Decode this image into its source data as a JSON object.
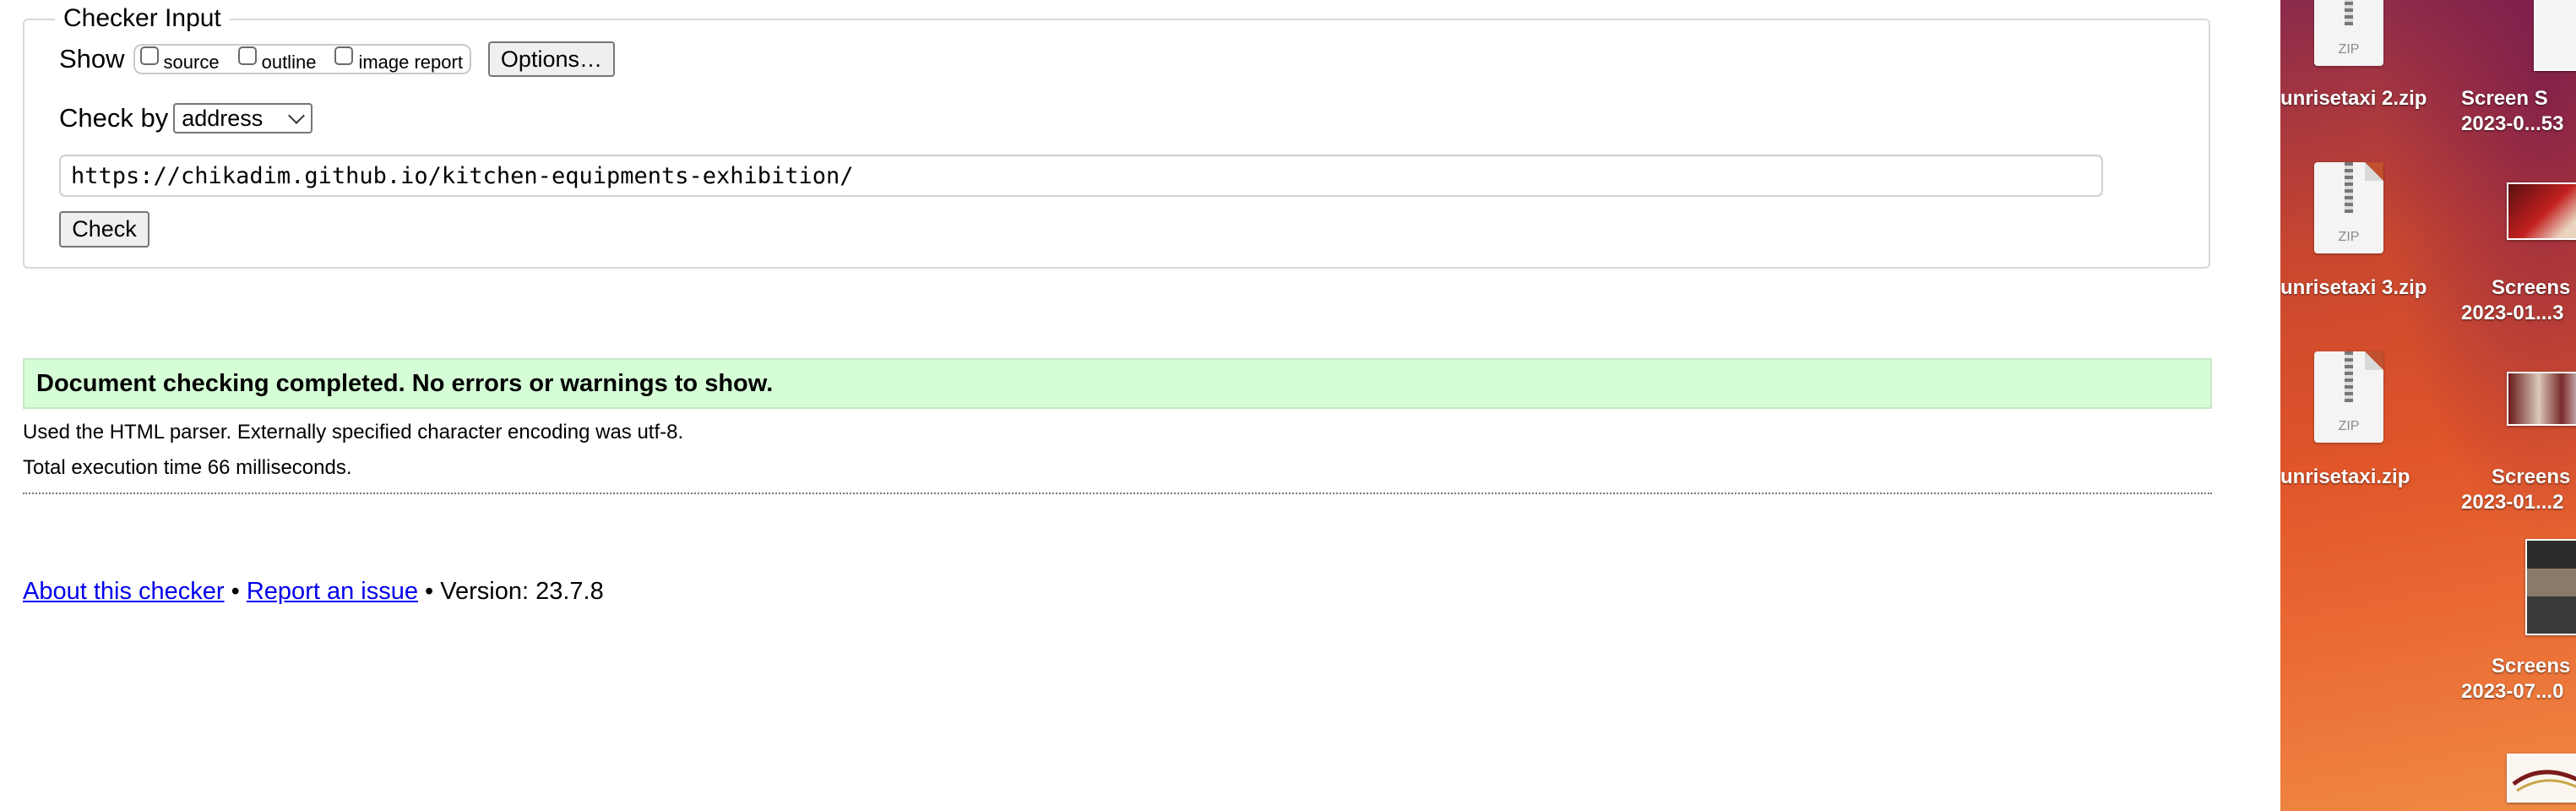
{
  "checker": {
    "legend": "Checker Input",
    "show_label": "Show",
    "show_options": [
      {
        "label": "source",
        "checked": false
      },
      {
        "label": "outline",
        "checked": false
      },
      {
        "label": "image report",
        "checked": false
      }
    ],
    "options_button": "Options…",
    "check_by_label": "Check by",
    "check_by_value": "address",
    "url": "https://chikadim.github.io/kitchen-equipments-exhibition/",
    "check_button": "Check"
  },
  "result": {
    "success_message": "Document checking completed. No errors or warnings to show.",
    "success_color": "#d5fdd6",
    "parser_info": "Used the HTML parser. Externally specified character encoding was utf-8.",
    "execution_time": "Total execution time 66 milliseconds."
  },
  "footer": {
    "about_link": "About this checker",
    "separator": "•",
    "report_link": "Report an issue",
    "version": "Version: 23.7.8"
  },
  "desktop": {
    "files": [
      {
        "name": "unrisetaxi 2.zip",
        "type": "ZIP"
      },
      {
        "name": "unrisetaxi 3.zip",
        "type": "ZIP"
      },
      {
        "name": "unrisetaxi.zip",
        "type": "ZIP"
      }
    ],
    "screenshots": [
      {
        "line1": "Screen S",
        "line2": "2023-0...53"
      },
      {
        "line1": "Screens",
        "line2": "2023-01...3"
      },
      {
        "line1": "Screens",
        "line2": "2023-01...2"
      },
      {
        "line1": "Screens",
        "line2": "2023-07...0"
      }
    ]
  }
}
